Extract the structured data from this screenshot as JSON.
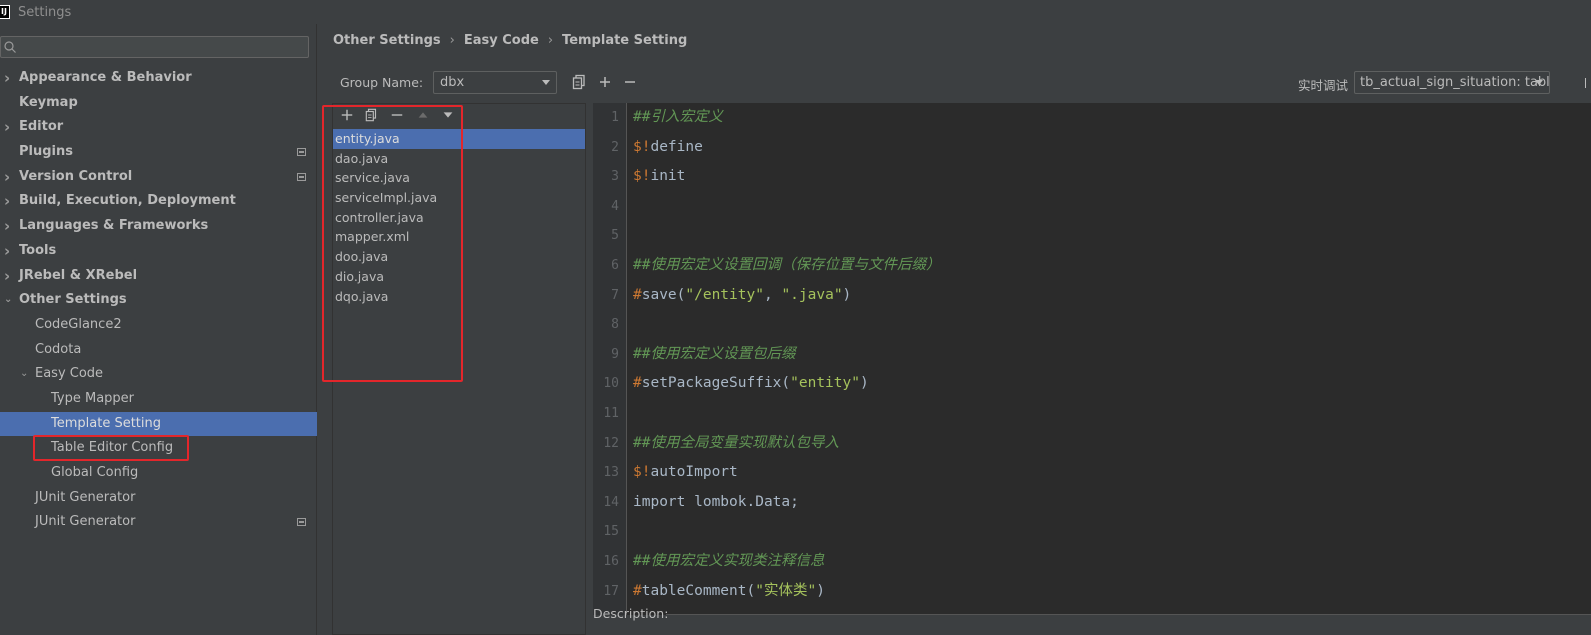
{
  "window": {
    "title": "Settings",
    "logo": "IJ"
  },
  "search": {
    "placeholder": "",
    "value": ""
  },
  "sidebar": {
    "items": [
      {
        "label": "Appearance & Behavior",
        "arrow": "›",
        "bold": true
      },
      {
        "label": "Keymap",
        "bold": true
      },
      {
        "label": "Editor",
        "arrow": "›",
        "bold": true
      },
      {
        "label": "Plugins",
        "bold": true,
        "icon": true
      },
      {
        "label": "Version Control",
        "arrow": "›",
        "bold": true,
        "icon": true
      },
      {
        "label": "Build, Execution, Deployment",
        "arrow": "›",
        "bold": true
      },
      {
        "label": "Languages & Frameworks",
        "arrow": "›",
        "bold": true
      },
      {
        "label": "Tools",
        "arrow": "›",
        "bold": true
      },
      {
        "label": "JRebel & XRebel",
        "arrow": "›",
        "bold": true
      },
      {
        "label": "Other Settings",
        "arrow": "⌄",
        "bold": true
      },
      {
        "label": "CodeGlance2",
        "indent": 1
      },
      {
        "label": "Codota",
        "indent": 1
      },
      {
        "label": "Easy Code",
        "arrow": "⌄",
        "indent": 1
      },
      {
        "label": "Type Mapper",
        "indent": 2
      },
      {
        "label": "Template Setting",
        "indent": 2,
        "selected": true
      },
      {
        "label": "Table Editor Config",
        "indent": 2
      },
      {
        "label": "Global Config",
        "indent": 2
      },
      {
        "label": "JUnit Generator",
        "indent": 1
      },
      {
        "label": "JUnit Generator",
        "indent": 1,
        "icon": true
      }
    ]
  },
  "breadcrumb": {
    "part1": "Other Settings",
    "part2": "Easy Code",
    "part3": "Template Setting",
    "separator": "›"
  },
  "group": {
    "label": "Group Name:",
    "value": "dbx"
  },
  "debug": {
    "label": "实时调试",
    "value": "tb_actual_sign_situation: table"
  },
  "files": {
    "items": [
      {
        "name": "entity.java",
        "selected": true
      },
      {
        "name": "dao.java"
      },
      {
        "name": "service.java"
      },
      {
        "name": "serviceImpl.java"
      },
      {
        "name": "controller.java"
      },
      {
        "name": "mapper.xml"
      },
      {
        "name": "doo.java"
      },
      {
        "name": "dio.java"
      },
      {
        "name": "dqo.java"
      }
    ]
  },
  "editor": {
    "lines": [
      {
        "n": "1",
        "segs": [
          [
            "cm-hash",
            "##"
          ],
          [
            "cm",
            "引入宏定义"
          ]
        ]
      },
      {
        "n": "2",
        "segs": [
          [
            "dir",
            "$!"
          ],
          [
            "",
            "define"
          ]
        ]
      },
      {
        "n": "3",
        "segs": [
          [
            "dir",
            "$!"
          ],
          [
            "",
            "init"
          ]
        ]
      },
      {
        "n": "4",
        "segs": []
      },
      {
        "n": "5",
        "segs": []
      },
      {
        "n": "6",
        "segs": [
          [
            "cm-hash",
            "##"
          ],
          [
            "cm",
            "使用宏定义设置回调（保存位置与文件后缀）"
          ]
        ]
      },
      {
        "n": "7",
        "segs": [
          [
            "dir",
            "#"
          ],
          [
            "",
            "save("
          ],
          [
            "str",
            "\"/entity\""
          ],
          [
            "",
            ", "
          ],
          [
            "str",
            "\".java\""
          ],
          [
            "",
            ")"
          ]
        ]
      },
      {
        "n": "8",
        "segs": []
      },
      {
        "n": "9",
        "segs": [
          [
            "cm-hash",
            "##"
          ],
          [
            "cm",
            "使用宏定义设置包后缀"
          ]
        ]
      },
      {
        "n": "10",
        "segs": [
          [
            "dir",
            "#"
          ],
          [
            "",
            "setPackageSuffix("
          ],
          [
            "str",
            "\"entity\""
          ],
          [
            "",
            ")"
          ]
        ]
      },
      {
        "n": "11",
        "segs": []
      },
      {
        "n": "12",
        "segs": [
          [
            "cm-hash",
            "##"
          ],
          [
            "cm",
            "使用全局变量实现默认包导入"
          ]
        ]
      },
      {
        "n": "13",
        "segs": [
          [
            "dir",
            "$!"
          ],
          [
            "",
            "autoImport"
          ]
        ]
      },
      {
        "n": "14",
        "segs": [
          [
            "",
            "import lombok.Data;"
          ]
        ]
      },
      {
        "n": "15",
        "segs": []
      },
      {
        "n": "16",
        "segs": [
          [
            "cm-hash",
            "##"
          ],
          [
            "cm",
            "使用宏定义实现类注释信息"
          ]
        ]
      },
      {
        "n": "17",
        "segs": [
          [
            "dir",
            "#"
          ],
          [
            "",
            "tableComment("
          ],
          [
            "str",
            "\"实体类\""
          ],
          [
            "",
            ")"
          ]
        ]
      }
    ]
  },
  "description": {
    "label": "Description:"
  },
  "colors": {
    "accent": "#4b6eaf",
    "highlight_box": "#e3262b",
    "background": "#3c3f41",
    "editor_bg": "#2b2b2b"
  }
}
